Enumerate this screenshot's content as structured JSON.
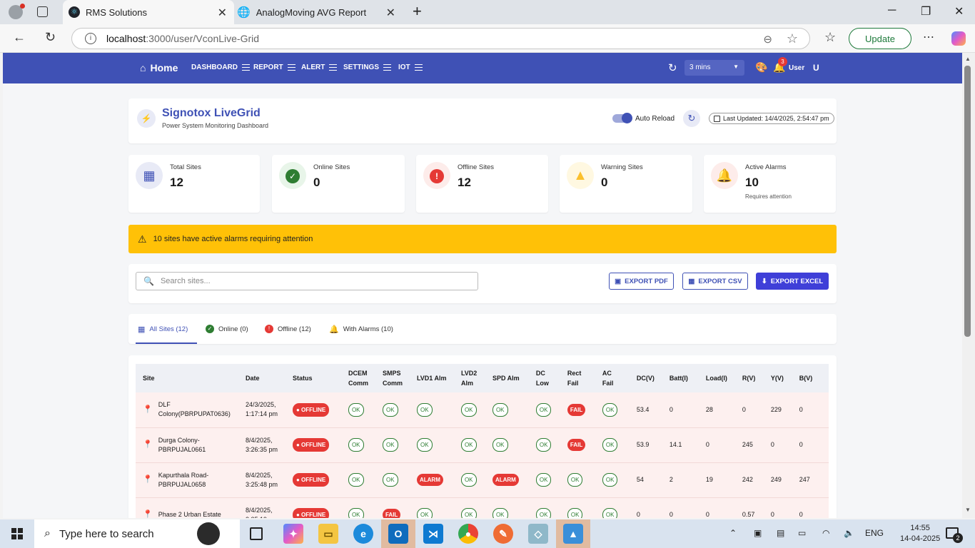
{
  "browser": {
    "tabs": [
      {
        "title": "RMS Solutions",
        "active": true
      },
      {
        "title": "AnalogMoving AVG Report",
        "active": false
      }
    ],
    "url_host": "localhost",
    "url_path": ":3000/user/VconLive-Grid",
    "update_label": "Update"
  },
  "appnav": {
    "home": "Home",
    "menus": [
      "DASHBOARD",
      "REPORT",
      "ALERT",
      "SETTINGS",
      "IOT"
    ],
    "refresh_interval": "3 mins",
    "notification_count": "3",
    "user_label": "User",
    "user_initial": "U"
  },
  "header": {
    "title": "Signotox LiveGrid",
    "subtitle": "Power System Monitoring Dashboard",
    "auto_reload_label": "Auto Reload",
    "auto_reload_on": true,
    "last_updated": "Last Updated: 14/4/2025, 2:54:47 pm"
  },
  "stats": [
    {
      "label": "Total Sites",
      "value": "12",
      "note": "",
      "color": "#3f51b5",
      "icon": "grid-icon"
    },
    {
      "label": "Online Sites",
      "value": "0",
      "note": "",
      "color": "#2e7d32",
      "icon": "check-circle-icon"
    },
    {
      "label": "Offline Sites",
      "value": "12",
      "note": "",
      "color": "#e53935",
      "icon": "error-icon"
    },
    {
      "label": "Warning Sites",
      "value": "0",
      "note": "",
      "color": "#fbc02d",
      "icon": "warning-icon"
    },
    {
      "label": "Active Alarms",
      "value": "10",
      "note": "Requires attention",
      "color": "#e53935",
      "icon": "bell-icon"
    }
  ],
  "alert_banner": "10 sites have active alarms requiring attention",
  "toolbar": {
    "search_placeholder": "Search sites...",
    "export_pdf": "EXPORT PDF",
    "export_csv": "EXPORT CSV",
    "export_excel": "EXPORT EXCEL"
  },
  "site_tabs": [
    {
      "label": "All Sites (12)",
      "active": true
    },
    {
      "label": "Online (0)",
      "active": false
    },
    {
      "label": "Offline (12)",
      "active": false
    },
    {
      "label": "With Alarms (10)",
      "active": false
    }
  ],
  "table": {
    "headers": [
      "Site",
      "Date",
      "Status",
      "DCEM Comm",
      "SMPS Comm",
      "LVD1 Alm",
      "LVD2 Alm",
      "SPD Alm",
      "DC Low",
      "Rect Fail",
      "AC Fail",
      "DC(V)",
      "Batt(I)",
      "Load(I)",
      "R(V)",
      "Y(V)",
      "B(V)"
    ],
    "rows": [
      {
        "site": "DLF Colony(PBRPUPAT0636)",
        "date": "24/3/2025, 1:17:14 pm",
        "status": "OFFLINE",
        "dcem": "OK",
        "smps": "OK",
        "lvd1": "OK",
        "lvd2": "OK",
        "spd": "OK",
        "dclow": "OK",
        "rect": "FAIL",
        "ac": "OK",
        "dcv": "53.4",
        "batt": "0",
        "load": "28",
        "r": "0",
        "y": "229",
        "b": "0"
      },
      {
        "site": "Durga Colony-PBRPUJAL0661",
        "date": "8/4/2025, 3:26:35 pm",
        "status": "OFFLINE",
        "dcem": "OK",
        "smps": "OK",
        "lvd1": "OK",
        "lvd2": "OK",
        "spd": "OK",
        "dclow": "OK",
        "rect": "FAIL",
        "ac": "OK",
        "dcv": "53.9",
        "batt": "14.1",
        "load": "0",
        "r": "245",
        "y": "0",
        "b": "0"
      },
      {
        "site": "Kapurthala Road-PBRPUJAL0658",
        "date": "8/4/2025, 3:25:48 pm",
        "status": "OFFLINE",
        "dcem": "OK",
        "smps": "OK",
        "lvd1": "ALARM",
        "lvd2": "OK",
        "spd": "ALARM",
        "dclow": "OK",
        "rect": "OK",
        "ac": "OK",
        "dcv": "54",
        "batt": "2",
        "load": "19",
        "r": "242",
        "y": "249",
        "b": "247"
      },
      {
        "site": "Phase 2 Urban Estate",
        "date": "8/4/2025, 3:25:19",
        "status": "OFFLINE",
        "dcem": "OK",
        "smps": "FAIL",
        "lvd1": "OK",
        "lvd2": "OK",
        "spd": "OK",
        "dclow": "OK",
        "rect": "OK",
        "ac": "OK",
        "dcv": "0",
        "batt": "0",
        "load": "0",
        "r": "0.57",
        "y": "0",
        "b": "0"
      }
    ]
  },
  "taskbar": {
    "search_placeholder": "Type here to search",
    "lang": "ENG",
    "time": "14:55",
    "date": "14-04-2025",
    "notif_count": "2"
  }
}
